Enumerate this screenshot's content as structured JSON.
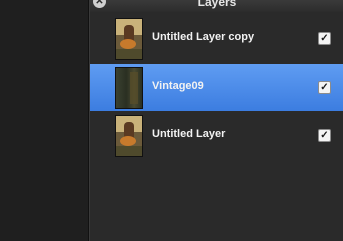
{
  "panel": {
    "title": "Layers",
    "close_glyph": "✕"
  },
  "layers": [
    {
      "name": "Untitled Layer copy",
      "visible": true,
      "selected": false,
      "check_glyph": "✓",
      "thumbnail": "guitarist-photo"
    },
    {
      "name": "Vintage09",
      "visible": true,
      "selected": true,
      "check_glyph": "✓",
      "thumbnail": "vintage-texture"
    },
    {
      "name": "Untitled Layer",
      "visible": true,
      "selected": false,
      "check_glyph": "✓",
      "thumbnail": "guitarist-photo"
    }
  ],
  "colors": {
    "selection_top": "#5f9cf2",
    "selection_bottom": "#3c7de0",
    "panel_bg": "#2a2a2a"
  }
}
